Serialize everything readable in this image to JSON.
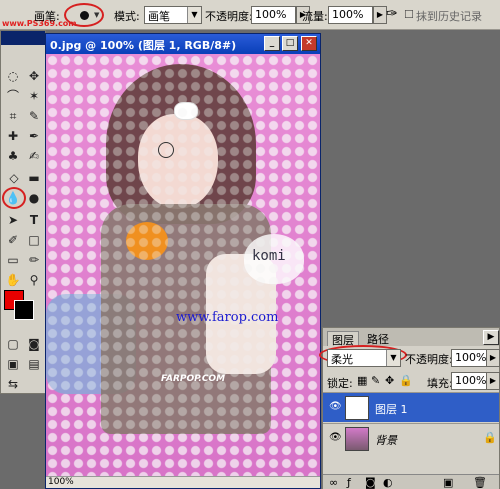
{
  "options_bar": {
    "brush_label": "画笔:",
    "mode_label": "模式:",
    "mode_value": "画笔",
    "opacity_label": "不透明度:",
    "opacity_value": "100%",
    "flow_label": "流量:",
    "flow_value": "100%",
    "history_label": "抹到历史记录",
    "site_watermark": "www.PS369.com"
  },
  "document": {
    "title": "0.jpg @ 100% (图层 1, RGB/8#)",
    "zoom_status": "100%",
    "canvas_text_komi": "komi",
    "canvas_text_url": "www.farop.com",
    "canvas_text_logo": "FARPOP.COM"
  },
  "layers_panel": {
    "tab_layers": "图层",
    "tab_paths": "路径",
    "blend_mode": "柔光",
    "opacity_label": "不透明度:",
    "opacity_value": "100%",
    "lock_label": "锁定:",
    "fill_label": "填充:",
    "fill_value": "100%",
    "layers": [
      {
        "name": "图层 1",
        "selected": true
      },
      {
        "name": "背景",
        "selected": false
      }
    ]
  },
  "colors": {
    "foreground": "#e80000",
    "background": "#000000",
    "accent_highlight": "#d62020",
    "selection_blue": "#2f5ec7"
  }
}
